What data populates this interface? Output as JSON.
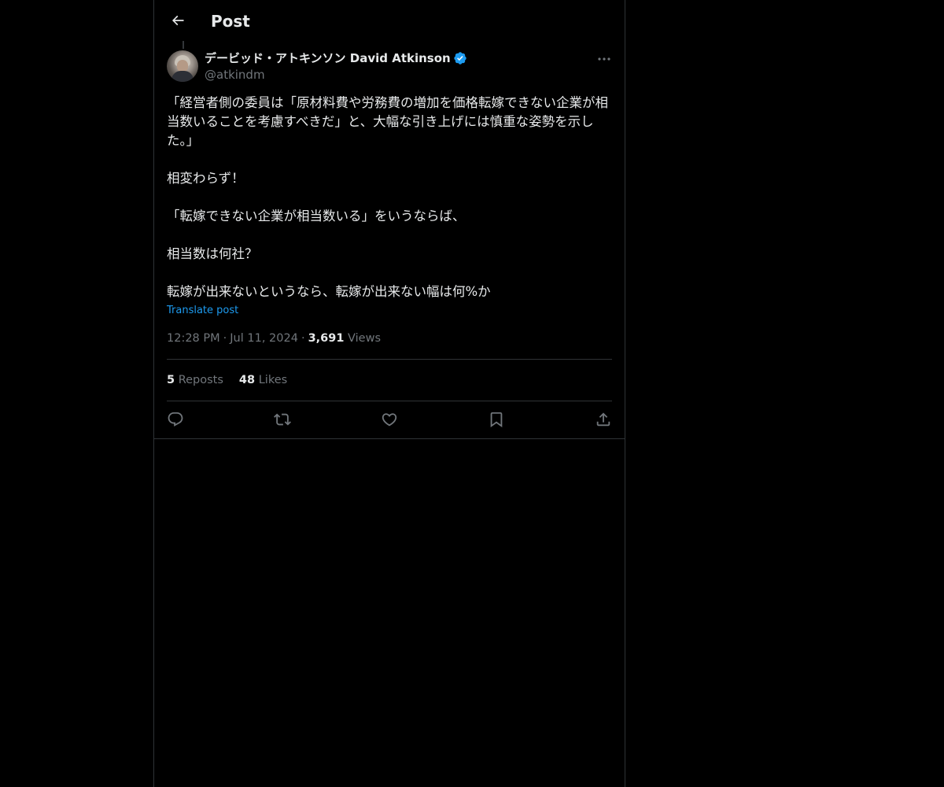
{
  "header": {
    "title": "Post",
    "back_icon": "arrow-left-icon"
  },
  "author": {
    "name": "デービッド・アトキンソン David Atkinson",
    "handle": "@atkindm",
    "verified": true,
    "verified_color": "#1d9bf0"
  },
  "post": {
    "text": "「経営者側の委員は「原材料費や労務費の増加を価格転嫁できない企業が相当数いることを考慮すべきだ」と、大幅な引き上げには慎重な姿勢を示した。」\n\n相変わらず！\n\n「転嫁できない企業が相当数いる」をいうならば、\n\n相当数は何社？\n\n転嫁が出来ないというなら、転嫁が出来ない幅は何%か",
    "translate_label": "Translate post",
    "time": "12:28 PM",
    "date": "Jul 11, 2024",
    "separator": "·",
    "views_count": "3,691",
    "views_label": "Views"
  },
  "stats": {
    "reposts_count": "5",
    "reposts_label": "Reposts",
    "likes_count": "48",
    "likes_label": "Likes"
  },
  "actions": [
    "reply-icon",
    "repost-icon",
    "like-icon",
    "bookmark-icon",
    "share-icon"
  ],
  "colors": {
    "background": "#000000",
    "text": "#e7e9ea",
    "secondary_text": "#71767b",
    "accent": "#1d9bf0",
    "border": "#2f3336"
  }
}
